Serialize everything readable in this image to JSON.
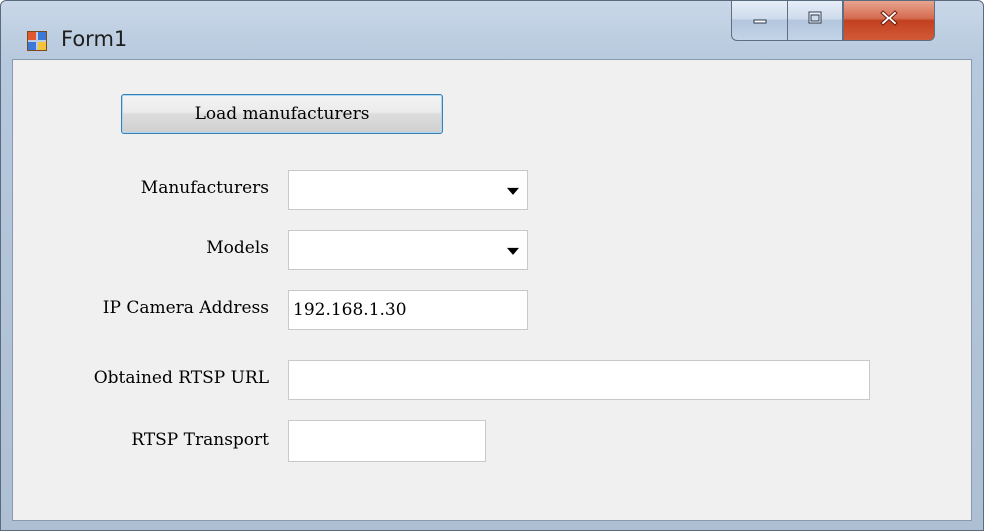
{
  "window": {
    "title": "Form1"
  },
  "form": {
    "load_button_label": "Load manufacturers",
    "manufacturers_label": "Manufacturers",
    "manufacturers_value": "",
    "models_label": "Models",
    "models_value": "",
    "ip_label": "IP Camera Address",
    "ip_value": "192.168.1.30",
    "rtsp_url_label": "Obtained RTSP URL",
    "rtsp_url_value": "",
    "rtsp_transport_label": "RTSP Transport",
    "rtsp_transport_value": ""
  },
  "icons": {
    "app": "form-window-icon",
    "minimize": "minimize-icon",
    "maximize": "maximize-icon",
    "close": "close-icon",
    "dropdown": "chevron-down-icon"
  },
  "colors": {
    "client_bg": "#f0f0f0",
    "frame_bg": "#aebfd3",
    "close_button": "#c2401f",
    "focus_border": "#3c7fb1"
  }
}
